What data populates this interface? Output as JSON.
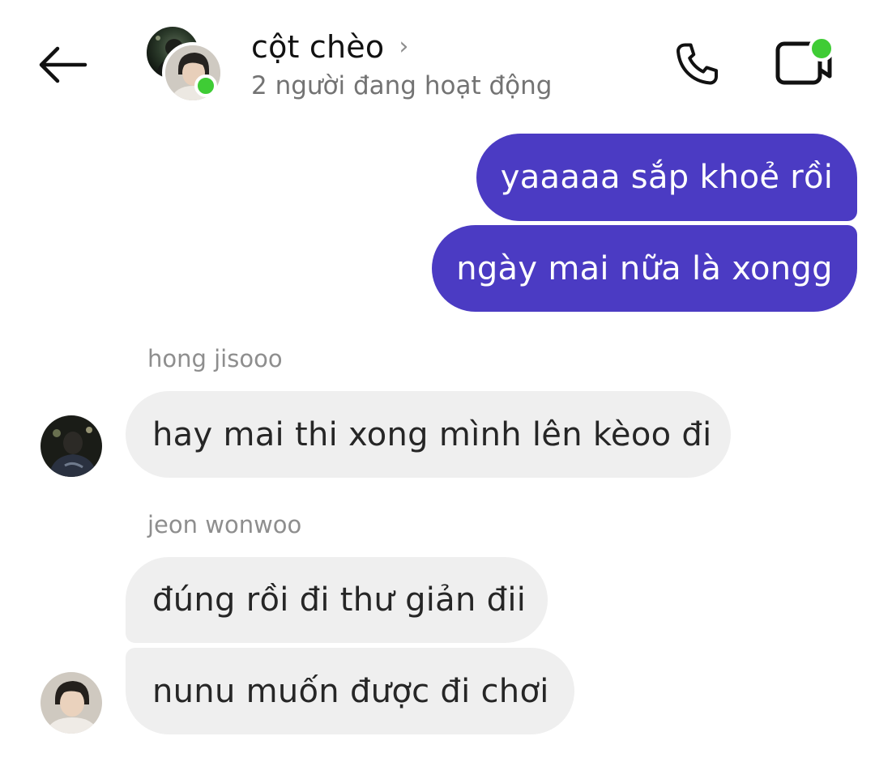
{
  "header": {
    "title": "cột chèo",
    "chevron": "›",
    "subtitle": "2 người đang hoạt động",
    "back_icon": "arrow-left-icon",
    "call_icon": "phone-icon",
    "video_icon": "video-camera-icon"
  },
  "colors": {
    "outgoing_bubble": "#4b3bc3",
    "incoming_bubble": "#efefef",
    "online_dot": "#3fcc35"
  },
  "messages": {
    "out_1": "yaaaaa sắp khoẻ rồi",
    "out_2": "ngày mai nữa là xongg",
    "sender_1": "hong jisooo",
    "in_1": "hay mai thi xong mình lên kèoo đi",
    "sender_2": "jeon wonwoo",
    "in_2": "đúng rồi đi thư giản đii",
    "in_3": "nunu muốn được đi chơi"
  }
}
